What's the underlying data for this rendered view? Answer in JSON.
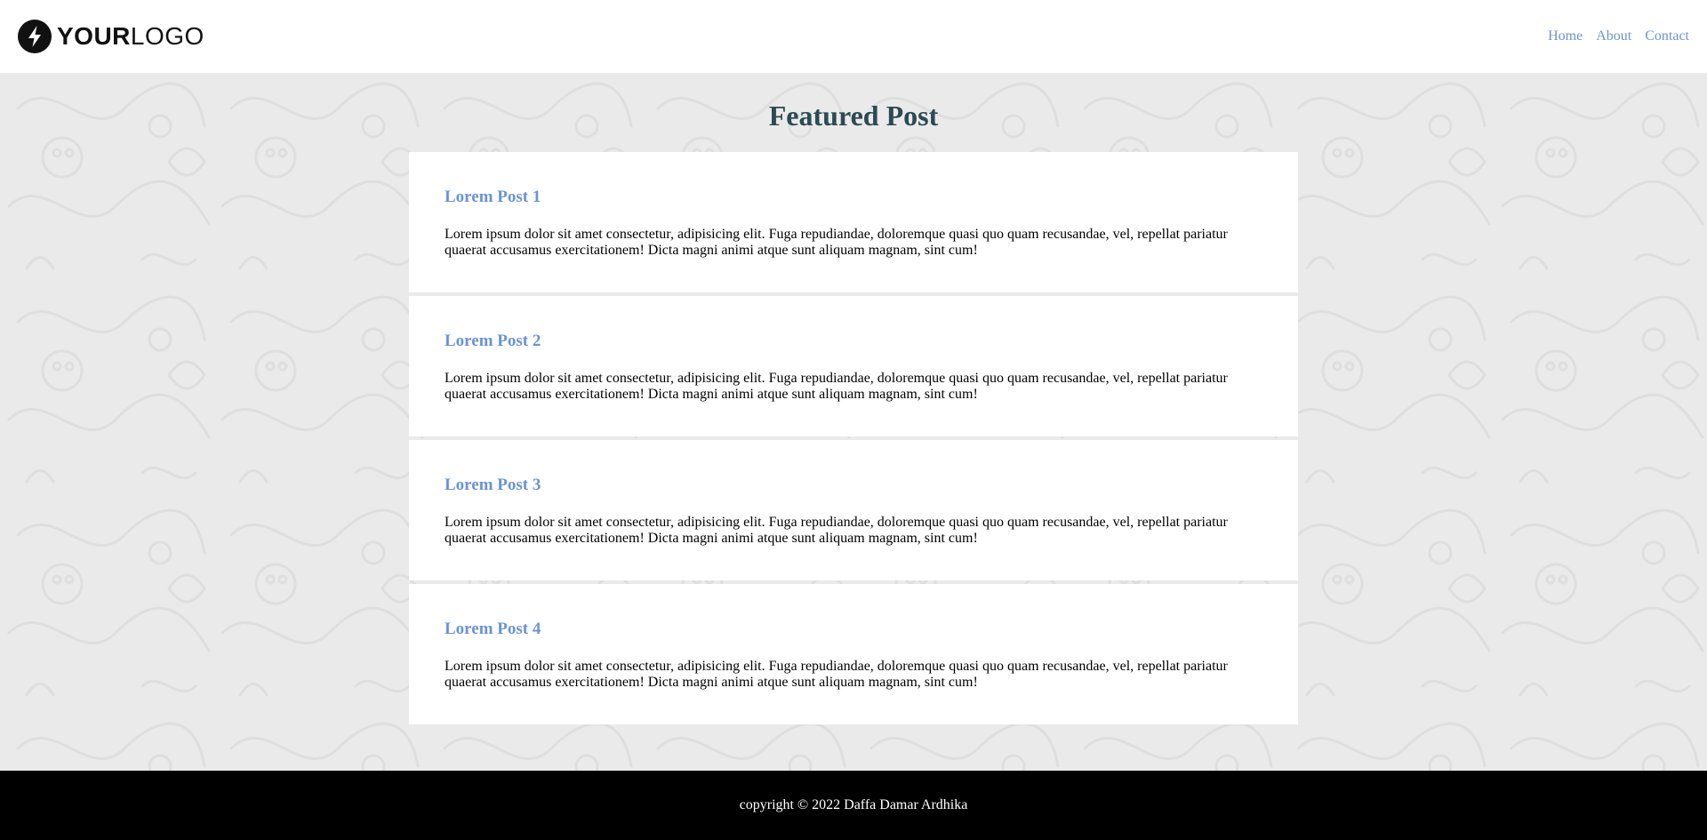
{
  "header": {
    "logo_bold": "YOUR",
    "logo_light": "LOGO",
    "logo_icon": "lightning-bolt-icon",
    "nav": [
      {
        "label": "Home"
      },
      {
        "label": "About"
      },
      {
        "label": "Contact"
      }
    ]
  },
  "main": {
    "title": "Featured Post",
    "posts": [
      {
        "title": "Lorem Post 1",
        "body": "Lorem ipsum dolor sit amet consectetur, adipisicing elit. Fuga repudiandae, doloremque quasi quo quam recusandae, vel, repellat pariatur quaerat accusamus exercitationem! Dicta magni animi atque sunt aliquam magnam, sint cum!"
      },
      {
        "title": "Lorem Post 2",
        "body": "Lorem ipsum dolor sit amet consectetur, adipisicing elit. Fuga repudiandae, doloremque quasi quo quam recusandae, vel, repellat pariatur quaerat accusamus exercitationem! Dicta magni animi atque sunt aliquam magnam, sint cum!"
      },
      {
        "title": "Lorem Post 3",
        "body": "Lorem ipsum dolor sit amet consectetur, adipisicing elit. Fuga repudiandae, doloremque quasi quo quam recusandae, vel, repellat pariatur quaerat accusamus exercitationem! Dicta magni animi atque sunt aliquam magnam, sint cum!"
      },
      {
        "title": "Lorem Post 4",
        "body": "Lorem ipsum dolor sit amet consectetur, adipisicing elit. Fuga repudiandae, doloremque quasi quo quam recusandae, vel, repellat pariatur quaerat accusamus exercitationem! Dicta magni animi atque sunt aliquam magnam, sint cum!"
      }
    ]
  },
  "footer": {
    "copyright": "copyright © 2022 Daffa Damar Ardhika"
  },
  "colors": {
    "link": "#6b93d6",
    "title": "#2c4a52",
    "page_bg": "#eaeaea",
    "footer_bg": "#000000"
  }
}
